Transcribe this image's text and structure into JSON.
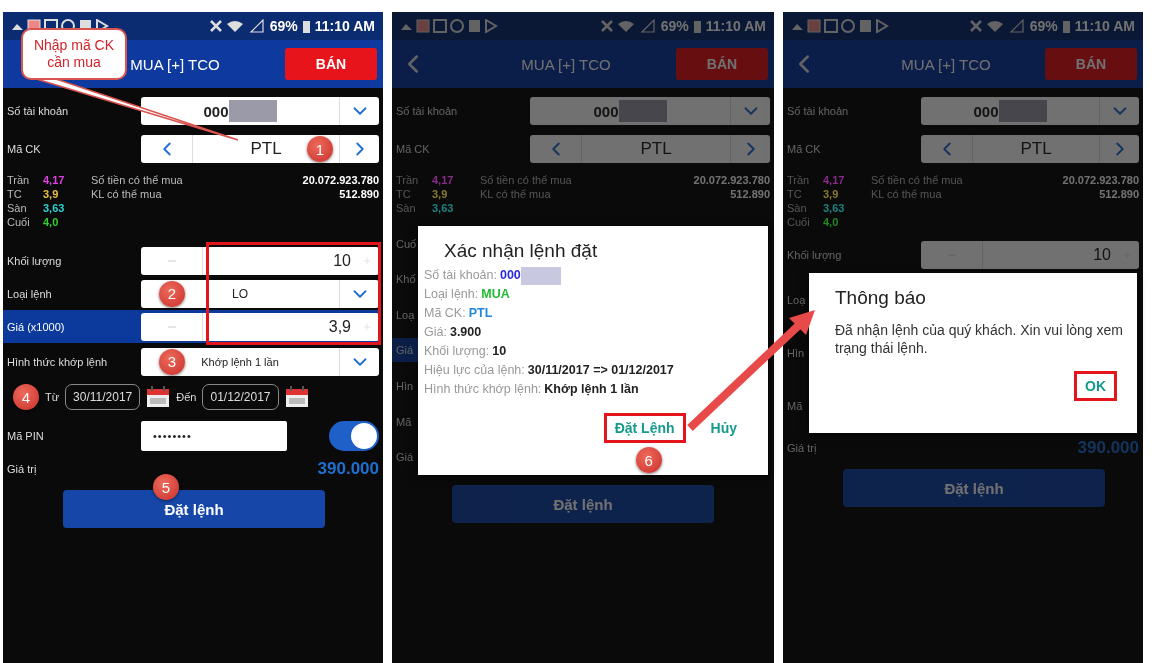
{
  "phones": [
    {
      "dimmed": false,
      "status_bar": {
        "battery": "69%",
        "time": "11:10 AM"
      },
      "header": {
        "back": false,
        "title": "MUA [+] TCO",
        "sell_button": "BÁN"
      },
      "callout": "Nhập mã CK cần mua",
      "sections": [
        {
          "kind": "account",
          "label": "Số tài khoản",
          "value": "000"
        },
        {
          "kind": "symbol",
          "label": "Mã CK",
          "value": "PTL",
          "badge": "1"
        },
        {
          "kind": "info",
          "prices": [
            {
              "label": "Trần",
              "value": "4,17",
              "color": "#e040e0"
            },
            {
              "label": "TC",
              "value": "3,9",
              "color": "#e8c040"
            },
            {
              "label": "Sàn",
              "value": "3,63",
              "color": "#30d0d0"
            },
            {
              "label": "Cuối",
              "value": "4,0",
              "color": "#30d030"
            }
          ],
          "balances": [
            {
              "label": "Số tiền có thể mua",
              "value": "20.072.923.780"
            },
            {
              "label": "KL có thể mua",
              "value": "512.890"
            }
          ]
        },
        {
          "kind": "group",
          "outlined": true,
          "rows": [
            {
              "kind": "number",
              "label": "Khối lượng",
              "value": "10",
              "highlighted": false
            },
            {
              "kind": "select",
              "label": "Loại lệnh",
              "value": "LO",
              "badge": "2",
              "highlighted": false
            },
            {
              "kind": "number",
              "label": "Giá (x1000)",
              "value": "3,9",
              "highlighted": true
            }
          ]
        },
        {
          "kind": "select",
          "label": "Hình thức khớp lệnh",
          "value": "Khớp lệnh 1 lần",
          "badge": "3",
          "highlighted": false
        },
        {
          "kind": "dates",
          "badge": "4",
          "from_label": "Từ",
          "from": "30/11/2017",
          "to_label": "Đến",
          "to": "01/12/2017"
        },
        {
          "kind": "pin",
          "label": "Mã PIN",
          "value": "••••••••",
          "toggle_on": true
        },
        {
          "kind": "total",
          "label": "Giá trị",
          "value": "390.000"
        },
        {
          "kind": "submit",
          "label": "Đặt lệnh",
          "badge": "5"
        }
      ]
    },
    {
      "dimmed": true,
      "status_bar": {
        "battery": "69%",
        "time": "11:10 AM"
      },
      "header": {
        "back": true,
        "title": "MUA [+] TCO",
        "sell_button": "BÁN"
      },
      "sections": [
        {
          "kind": "account",
          "label": "Số tài khoản",
          "value": "000"
        },
        {
          "kind": "symbol",
          "label": "Mã CK",
          "value": "PTL"
        },
        {
          "kind": "info",
          "prices": [
            {
              "label": "Trần",
              "value": "4,17",
              "color": "#8a2a8a"
            },
            {
              "label": "TC",
              "value": "3,9",
              "color": "#8a7a30"
            },
            {
              "label": "Sàn",
              "value": "3,63",
              "color": "#1f8080"
            }
          ],
          "balances": [
            {
              "label": "Số tiền có thể mua",
              "value": "20.072.923.780"
            },
            {
              "label": "KL có thể mua",
              "value": "512.890"
            }
          ]
        },
        {
          "kind": "dialog",
          "covered_labels": [
            {
              "label": "Cuố",
              "highlighted": false
            },
            {
              "label": "Khố",
              "highlighted": false
            },
            {
              "label": "Loạ",
              "highlighted": false
            },
            {
              "label": "Giá",
              "highlighted": true
            },
            {
              "label": "Hìn",
              "highlighted": false
            },
            {
              "label": "Mã",
              "highlighted": false
            },
            {
              "label": "Giá",
              "highlighted": false
            }
          ],
          "dialog": {
            "title": "Xác nhận lệnh đặt",
            "lines": [
              {
                "label": "Số tài khoản:",
                "value": "000",
                "color": "#2a2ae0",
                "masked": true
              },
              {
                "label": "Loại lệnh:",
                "value": "MUA",
                "color": "#22bb33",
                "masked": false
              },
              {
                "label": "Mã CK:",
                "value": "PTL",
                "color": "#2288dd",
                "masked": false
              },
              {
                "label": "Giá:",
                "value": "3.900",
                "color": "#222222",
                "masked": false
              },
              {
                "label": "Khối lượng:",
                "value": "10",
                "color": "#222222",
                "masked": false
              },
              {
                "label": "Hiệu lực của lệnh:",
                "value": "30/11/2017 => 01/12/2017",
                "color": "#222222",
                "masked": false
              },
              {
                "label": "Hình thức khớp lệnh:",
                "value": "Khớp lệnh 1 lần",
                "color": "#222222",
                "masked": false
              }
            ],
            "buttons": [
              {
                "label": "Đặt Lệnh",
                "outlined": true,
                "badge": "6"
              },
              {
                "label": "Hủy",
                "outlined": false
              }
            ]
          }
        },
        {
          "kind": "submit",
          "label": "Đặt lệnh"
        }
      ]
    },
    {
      "dimmed": true,
      "status_bar": {
        "battery": "69%",
        "time": "11:10 AM"
      },
      "header": {
        "back": true,
        "title": "MUA [+] TCO",
        "sell_button": "BÁN"
      },
      "sections": [
        {
          "kind": "account",
          "label": "Số tài khoản",
          "value": "000"
        },
        {
          "kind": "symbol",
          "label": "Mã CK",
          "value": "PTL"
        },
        {
          "kind": "info",
          "prices": [
            {
              "label": "Trần",
              "value": "4,17",
              "color": "#8a2a8a"
            },
            {
              "label": "TC",
              "value": "3,9",
              "color": "#8a7a30"
            },
            {
              "label": "Sàn",
              "value": "3,63",
              "color": "#1f8080"
            },
            {
              "label": "Cuối",
              "value": "4,0",
              "color": "#1f8a1f"
            }
          ],
          "balances": [
            {
              "label": "Số tiền có thể mua",
              "value": "20.072.923.780"
            },
            {
              "label": "KL có thể mua",
              "value": "512.890"
            }
          ]
        },
        {
          "kind": "number",
          "label": "Khối lượng",
          "value": "10",
          "highlighted": false
        },
        {
          "kind": "dialog",
          "covered_labels": [
            {
              "label": "Loạ",
              "highlighted": false
            },
            {
              "label": "Hìn",
              "highlighted": false
            },
            {
              "label": "Mã",
              "highlighted": false
            }
          ],
          "dialog": {
            "title": "Thông báo",
            "message": "Đã nhận lệnh của quý khách. Xin vui lòng xem trạng thái lệnh.",
            "buttons": [
              {
                "label": "OK",
                "outlined": true
              }
            ]
          }
        },
        {
          "kind": "total",
          "label": "Giá trị",
          "value": "390.000"
        },
        {
          "kind": "submit",
          "label": "Đặt lệnh"
        }
      ]
    }
  ]
}
